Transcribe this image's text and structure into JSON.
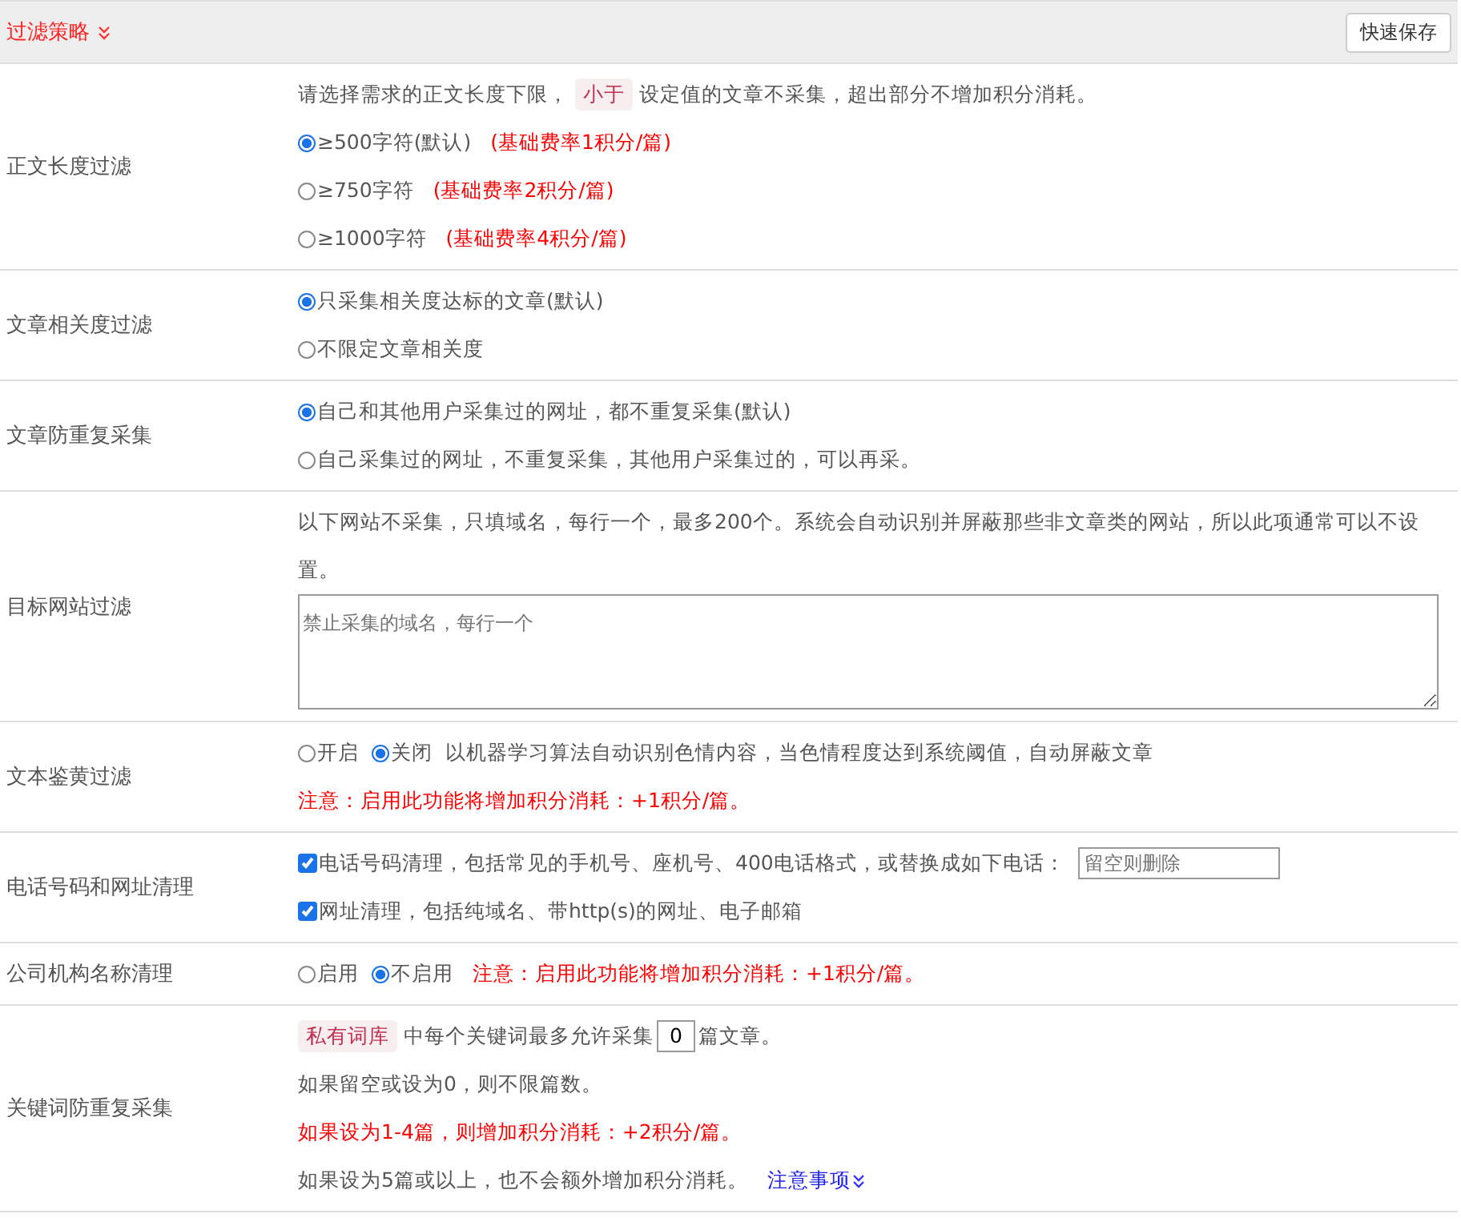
{
  "header": {
    "title": "过滤策略",
    "save_button": "快速保存"
  },
  "sections": [
    {
      "label": "正文长度过滤",
      "lines": [
        {
          "parts": [
            {
              "kind": "text",
              "text": "请选择需求的正文长度下限，"
            },
            {
              "kind": "tag",
              "text": "小于"
            },
            {
              "kind": "text",
              "text": "设定值的文章不采集，超出部分不增加积分消耗。"
            }
          ]
        },
        {
          "parts": [
            {
              "kind": "radio",
              "label": "≥500字符(默认)",
              "selected": true
            },
            {
              "kind": "warning",
              "text": "(基础费率1积分/篇)"
            }
          ]
        },
        {
          "parts": [
            {
              "kind": "radio",
              "label": "≥750字符",
              "selected": false
            },
            {
              "kind": "warning",
              "text": "(基础费率2积分/篇)"
            }
          ]
        },
        {
          "parts": [
            {
              "kind": "radio",
              "label": "≥1000字符",
              "selected": false
            },
            {
              "kind": "warning",
              "text": "(基础费率4积分/篇)"
            }
          ]
        }
      ]
    },
    {
      "label": "文章相关度过滤",
      "lines": [
        {
          "parts": [
            {
              "kind": "radio",
              "label": "只采集相关度达标的文章(默认)",
              "selected": true
            }
          ]
        },
        {
          "parts": [
            {
              "kind": "radio",
              "label": "不限定文章相关度",
              "selected": false
            }
          ]
        }
      ]
    },
    {
      "label": "文章防重复采集",
      "lines": [
        {
          "parts": [
            {
              "kind": "radio",
              "label": "自己和其他用户采集过的网址，都不重复采集(默认)",
              "selected": true
            }
          ]
        },
        {
          "parts": [
            {
              "kind": "radio",
              "label": "自己采集过的网址，不重复采集，其他用户采集过的，可以再采。",
              "selected": false
            }
          ]
        }
      ]
    },
    {
      "label": "目标网站过滤",
      "lines": [
        {
          "parts": [
            {
              "kind": "text",
              "text": "以下网站不采集，只填域名，每行一个，最多200个。系统会自动识别并屏蔽那些非文章类的网站，所以此项通常可以不设置。"
            }
          ]
        },
        {
          "parts": [
            {
              "kind": "textarea",
              "placeholder": "禁止采集的域名，每行一个"
            }
          ]
        }
      ]
    },
    {
      "label": "文本鉴黄过滤",
      "lines": [
        {
          "parts": [
            {
              "kind": "radio",
              "label": "开启",
              "selected": false
            },
            {
              "kind": "radio",
              "label": "关闭",
              "selected": true
            },
            {
              "kind": "text",
              "text": "以机器学习算法自动识别色情内容，当色情程度达到系统阈值，自动屏蔽文章"
            }
          ]
        },
        {
          "parts": [
            {
              "kind": "warning",
              "text": "注意：启用此功能将增加积分消耗：+1积分/篇。"
            }
          ]
        }
      ]
    },
    {
      "label": "电话号码和网址清理",
      "lines": [
        {
          "parts": [
            {
              "kind": "checkbox",
              "label": "电话号码清理，包括常见的手机号、座机号、400电话格式，或替换成如下电话：",
              "checked": true
            },
            {
              "kind": "input",
              "placeholder": "留空则删除"
            }
          ]
        },
        {
          "parts": [
            {
              "kind": "checkbox",
              "label": "网址清理，包括纯域名、带http(s)的网址、电子邮箱",
              "checked": true
            }
          ]
        }
      ]
    },
    {
      "label": "公司机构名称清理",
      "lines": [
        {
          "parts": [
            {
              "kind": "radio",
              "label": "启用",
              "selected": false
            },
            {
              "kind": "radio",
              "label": "不启用",
              "selected": true
            },
            {
              "kind": "warning",
              "text": "注意：启用此功能将增加积分消耗：+1积分/篇。"
            }
          ]
        }
      ]
    },
    {
      "label": "关键词防重复采集",
      "lines": [
        {
          "parts": [
            {
              "kind": "tag",
              "text": "私有词库"
            },
            {
              "kind": "text",
              "text": "中每个关键词最多允许采集"
            },
            {
              "kind": "number",
              "value": "0"
            },
            {
              "kind": "text",
              "text": "篇文章。"
            }
          ]
        },
        {
          "parts": [
            {
              "kind": "text",
              "text": "如果留空或设为0，则不限篇数。"
            }
          ]
        },
        {
          "parts": [
            {
              "kind": "warning",
              "text": "如果设为1-4篇，则增加积分消耗：+2积分/篇。"
            }
          ]
        },
        {
          "parts": [
            {
              "kind": "text",
              "text": "如果设为5篇或以上，也不会额外增加积分消耗。"
            },
            {
              "kind": "link",
              "text": "注意事项"
            }
          ]
        }
      ]
    }
  ]
}
